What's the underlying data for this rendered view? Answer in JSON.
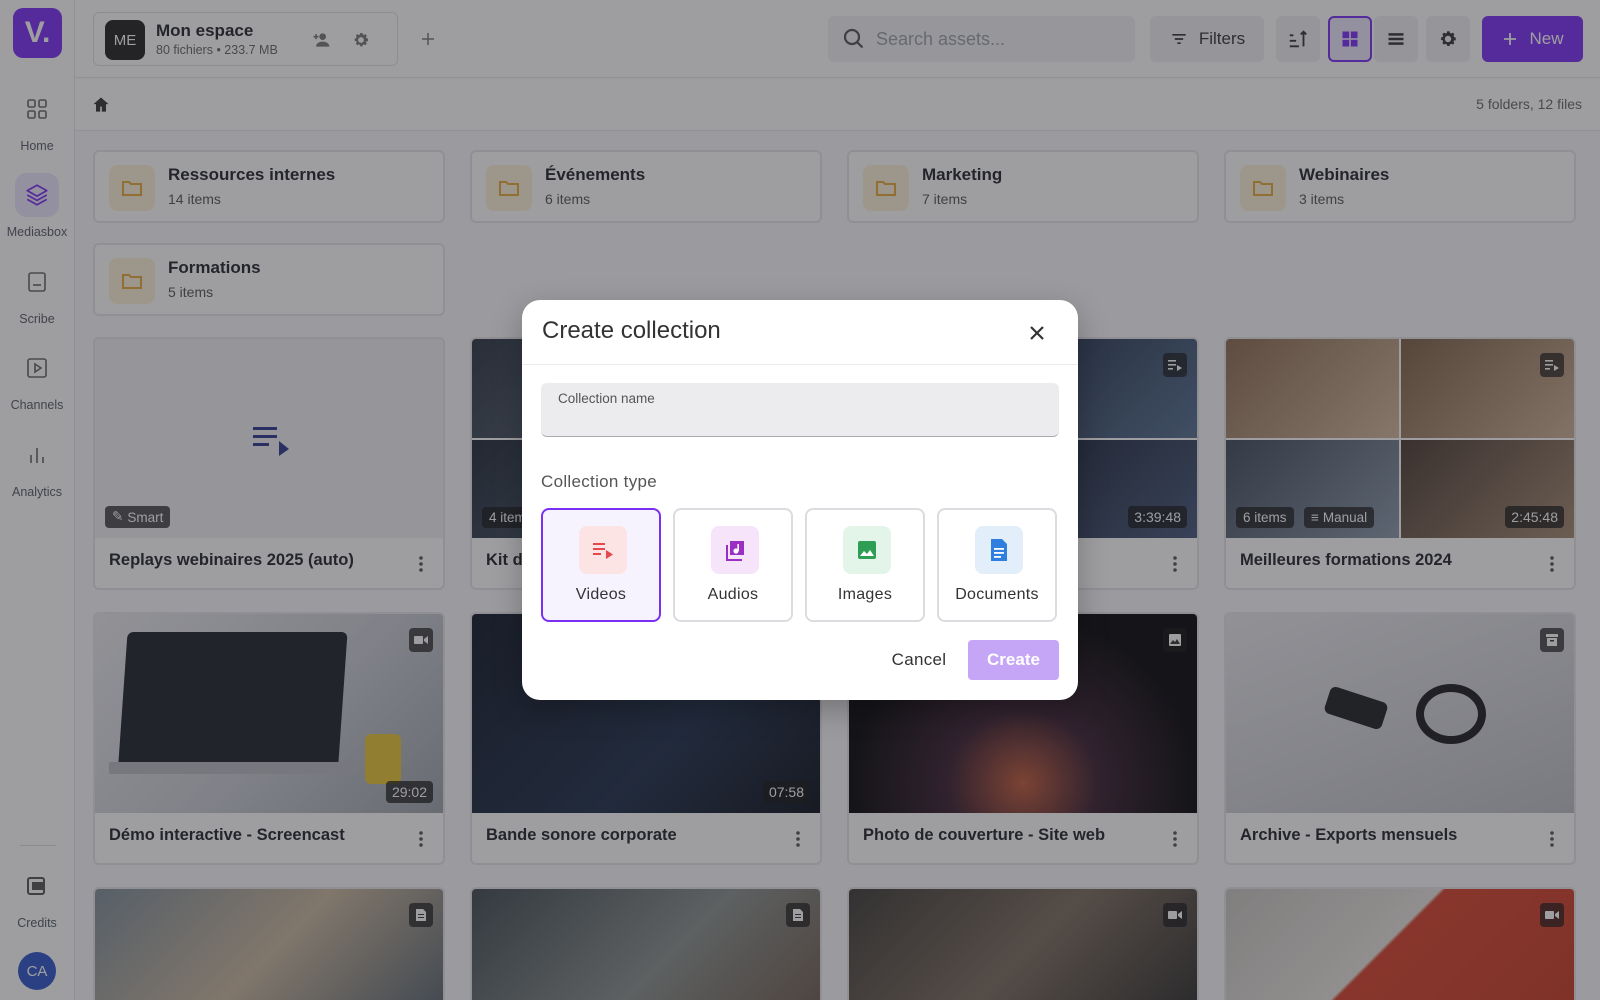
{
  "sidebar": {
    "logo": "V.",
    "items": [
      {
        "label": "Home",
        "icon": "grid-icon"
      },
      {
        "label": "Mediasbox",
        "icon": "layers-icon"
      },
      {
        "label": "Scribe",
        "icon": "document-icon"
      },
      {
        "label": "Channels",
        "icon": "play-icon"
      },
      {
        "label": "Analytics",
        "icon": "bar-chart-icon"
      }
    ],
    "credits_label": "Credits",
    "user_initials": "CA"
  },
  "header": {
    "space": {
      "initials": "ME",
      "name": "Mon espace",
      "meta": "80 fichiers • 233.7 MB"
    },
    "search_placeholder": "Search assets...",
    "filters_label": "Filters",
    "new_label": "New"
  },
  "breadcrumb": {
    "counts": "5 folders, 12 files"
  },
  "folders": [
    {
      "name": "Ressources internes",
      "count": "14 items"
    },
    {
      "name": "Événements",
      "count": "6 items"
    },
    {
      "name": "Marketing",
      "count": "7 items"
    },
    {
      "name": "Webinaires",
      "count": "3 items"
    },
    {
      "name": "Formations",
      "count": "5 items"
    }
  ],
  "cards": [
    {
      "title": "Replays webinaires 2025 (auto)",
      "tag": "Smart"
    },
    {
      "title": "Kit d",
      "items": "4 items"
    },
    {
      "title": "",
      "duration": "3:39:48"
    },
    {
      "title": "Meilleures formations 2024",
      "items": "6 items",
      "tag": "Manual",
      "duration": "2:45:48"
    },
    {
      "title": "Démo interactive - Screencast",
      "duration": "29:02"
    },
    {
      "title": "Bande sonore corporate",
      "duration": "07:58"
    },
    {
      "title": "Photo de couverture - Site web"
    },
    {
      "title": "Archive - Exports mensuels"
    }
  ],
  "modal": {
    "title": "Create collection",
    "name_label": "Collection name",
    "name_value": "",
    "type_label": "Collection type",
    "types": [
      {
        "label": "Videos",
        "selected": true,
        "color": "#e5484d"
      },
      {
        "label": "Audios",
        "selected": false,
        "color": "#9b2fc4"
      },
      {
        "label": "Images",
        "selected": false,
        "color": "#2f9e55"
      },
      {
        "label": "Documents",
        "selected": false,
        "color": "#2f7fe0"
      }
    ],
    "cancel_label": "Cancel",
    "create_label": "Create"
  },
  "colors": {
    "accent": "#7a2ff5",
    "folder": "#e8a93a"
  }
}
